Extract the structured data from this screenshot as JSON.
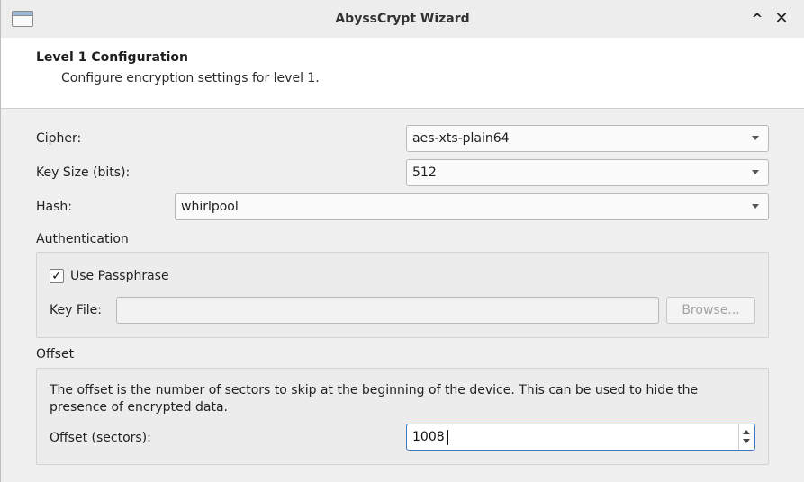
{
  "window": {
    "title": "AbyssCrypt Wizard"
  },
  "header": {
    "title": "Level 1 Configuration",
    "subtitle": "Configure encryption settings for level 1."
  },
  "cipher": {
    "label": "Cipher:",
    "value": "aes-xts-plain64"
  },
  "key_size": {
    "label": "Key Size (bits):",
    "value": "512"
  },
  "hash": {
    "label": "Hash:",
    "value": "whirlpool"
  },
  "authentication": {
    "title": "Authentication",
    "use_passphrase": {
      "label": "Use Passphrase",
      "checked": true,
      "mark": "✓"
    },
    "key_file": {
      "label": "Key File:",
      "value": ""
    },
    "browse_label": "Browse..."
  },
  "offset": {
    "title": "Offset",
    "description": "The offset is the number of sectors to skip at the beginning of the device. This can be used to hide the presence of encrypted data.",
    "sectors_label": "Offset (sectors):",
    "sectors_value": "1008"
  },
  "icons": {
    "maximize": "^",
    "close": "✕"
  }
}
